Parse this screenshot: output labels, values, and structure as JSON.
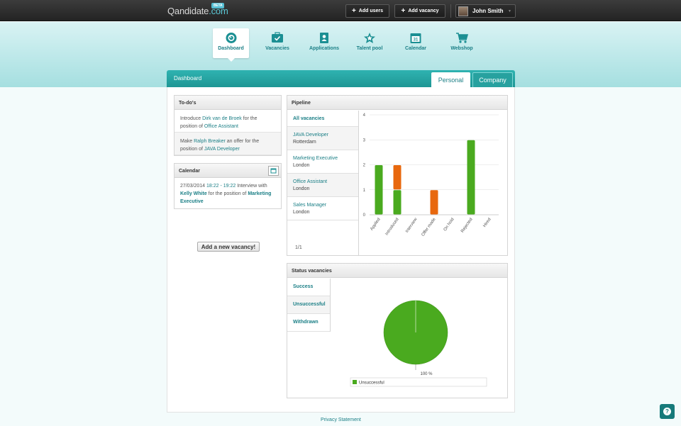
{
  "header": {
    "logo_text": "Qandidate",
    "logo_suffix": ".com",
    "logo_badge": "BETA",
    "add_users_label": "Add users",
    "add_vacancy_label": "Add vacancy",
    "user_name": "John Smith"
  },
  "nav": {
    "items": [
      {
        "label": "Dashboard",
        "icon": "dashboard-icon"
      },
      {
        "label": "Vacancies",
        "icon": "vacancies-icon"
      },
      {
        "label": "Applications",
        "icon": "applications-icon"
      },
      {
        "label": "Talent pool",
        "icon": "star-icon"
      },
      {
        "label": "Calendar",
        "icon": "calendar-icon"
      },
      {
        "label": "Webshop",
        "icon": "cart-icon"
      }
    ],
    "active": "Dashboard"
  },
  "dashboard": {
    "title": "Dashboard",
    "tabs": {
      "personal": "Personal",
      "company": "Company"
    }
  },
  "todos": {
    "title": "To-do's",
    "items": [
      {
        "pre": "Introduce ",
        "person": "Dirk van de Broek",
        "mid": " for the position of ",
        "position": "Office Assistant"
      },
      {
        "pre": "Make ",
        "person": "Ralph Breaker",
        "mid": " an offer for the position of ",
        "position": "JAVA Developer"
      }
    ]
  },
  "calendar": {
    "title": "Calendar",
    "date": "27/03/2014",
    "time": "18:22 - 19:22",
    "mid": " Interview with ",
    "person": "Kelly White",
    "mid2": " for the position of ",
    "position": "Marketing Executive"
  },
  "add_vacancy_button": "Add a new vacancy!",
  "pipeline": {
    "title": "Pipeline",
    "all_label": "All vacancies",
    "vacancies": [
      {
        "name": "JAVA Developer",
        "location": "Rotterdam"
      },
      {
        "name": "Marketing Executive",
        "location": "London"
      },
      {
        "name": "Office Assistant",
        "location": "London"
      },
      {
        "name": "Sales Manager",
        "location": "London"
      }
    ],
    "pager": "1/1"
  },
  "status": {
    "title": "Status vacancies",
    "items": [
      "Success",
      "Unsuccessful",
      "Withdrawn"
    ]
  },
  "chart_data": [
    {
      "type": "bar",
      "categories": [
        "Applied",
        "Introduced",
        "Interview",
        "Offer made",
        "On hold",
        "Rejected",
        "Hired"
      ],
      "series": [
        {
          "color": "#4aaa1f",
          "values": [
            2,
            1,
            0,
            0,
            0,
            3,
            0
          ]
        },
        {
          "color": "#e8680e",
          "values": [
            0,
            1,
            0,
            1,
            0,
            0,
            0
          ]
        }
      ],
      "ylim": [
        0,
        4
      ],
      "yticks": [
        0,
        1,
        2,
        3,
        4
      ],
      "stacked": true,
      "grid": true
    },
    {
      "type": "pie",
      "slices": [
        {
          "label": "Unsuccessful",
          "value": 100,
          "color": "#4aaa1f"
        }
      ],
      "data_label": "100 %",
      "legend": [
        "Unsuccessful"
      ]
    }
  ],
  "footer": {
    "privacy": "Privacy Statement"
  }
}
